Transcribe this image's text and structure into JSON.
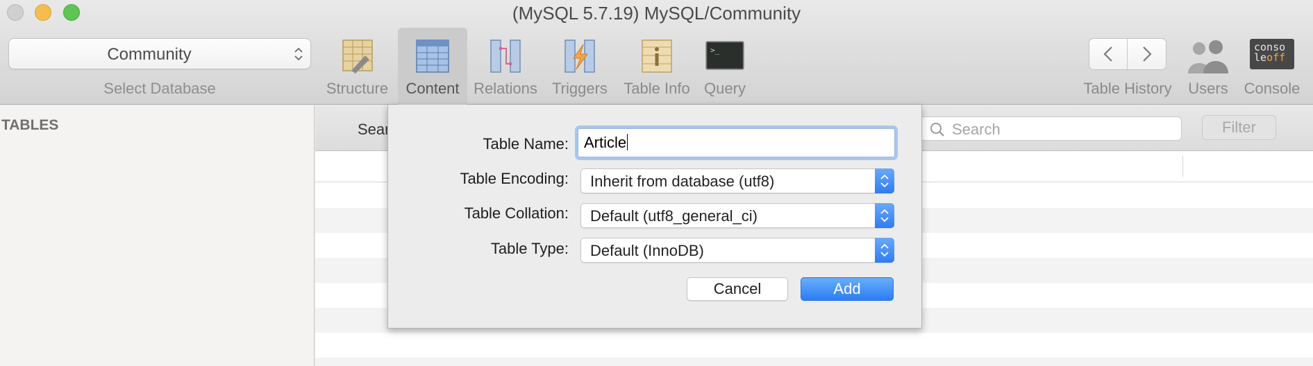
{
  "window": {
    "title": "(MySQL 5.7.19) MySQL/Community"
  },
  "toolbar": {
    "database_select": {
      "value": "Community",
      "label": "Select Database"
    },
    "buttons": [
      {
        "label": "Structure",
        "icon": "structure-icon"
      },
      {
        "label": "Content",
        "icon": "content-icon",
        "selected": true
      },
      {
        "label": "Relations",
        "icon": "relations-icon"
      },
      {
        "label": "Triggers",
        "icon": "triggers-icon"
      },
      {
        "label": "Table Info",
        "icon": "table-info-icon"
      },
      {
        "label": "Query",
        "icon": "query-icon"
      }
    ],
    "table_history": {
      "label": "Table History"
    },
    "users": {
      "label": "Users"
    },
    "console": {
      "label": "Console",
      "icon_text_top": "conso",
      "icon_text_mid": "le",
      "icon_text_off": "off"
    }
  },
  "sidebar": {
    "heading": "TABLES"
  },
  "main": {
    "filter_bar": {
      "label": "Sear",
      "search_placeholder": "Search",
      "filter_label": "Filter"
    }
  },
  "dialog": {
    "name_label": "Table Name:",
    "name_value": "Article",
    "encoding_label": "Table Encoding:",
    "encoding_value": "Inherit from database (utf8)",
    "collation_label": "Table Collation:",
    "collation_value": "Default (utf8_general_ci)",
    "type_label": "Table Type:",
    "type_value": "Default (InnoDB)",
    "cancel_label": "Cancel",
    "add_label": "Add"
  },
  "colors": {
    "accent": "#2f7cf2",
    "focus_ring": "#a8c6ef",
    "selected_tab": "#cbcbcb"
  }
}
